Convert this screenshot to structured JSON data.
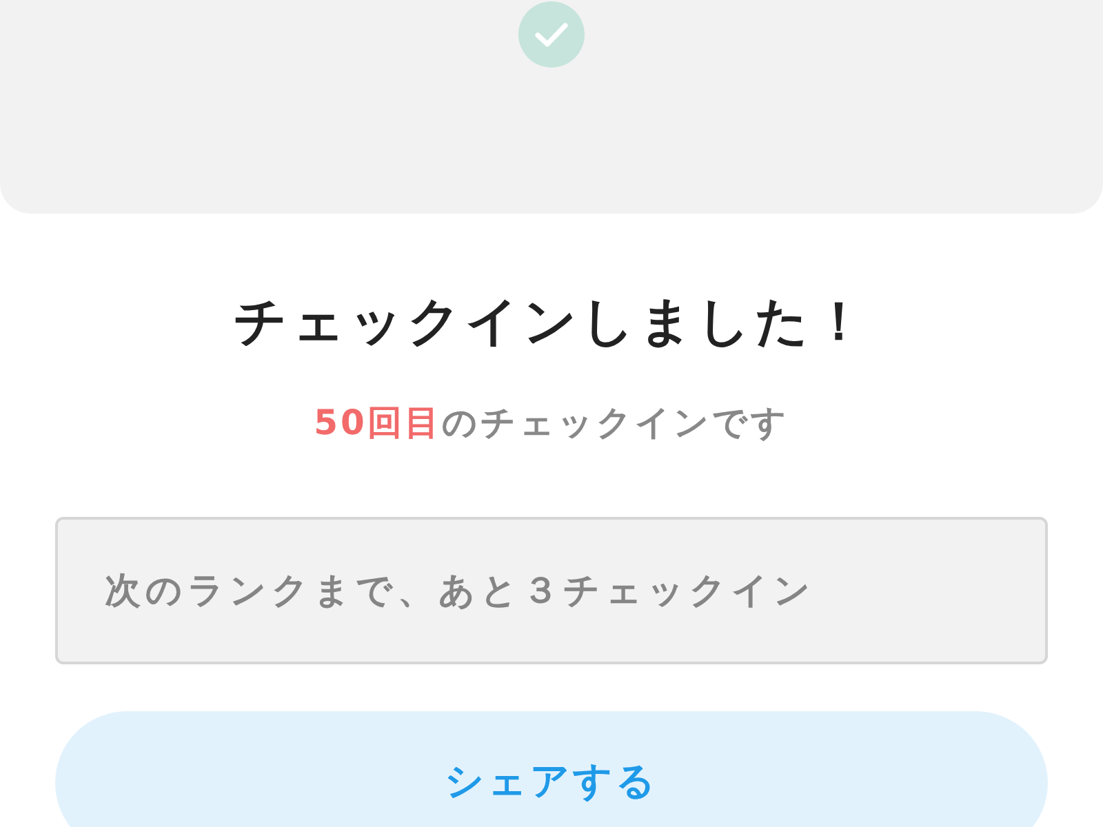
{
  "title": "チェックインしました！",
  "subtitle": {
    "highlight": "50回目",
    "text": "のチェックインです"
  },
  "next_rank": {
    "text": "次のランクまで、あと３チェックイン"
  },
  "share_button": {
    "label": "シェアする"
  }
}
